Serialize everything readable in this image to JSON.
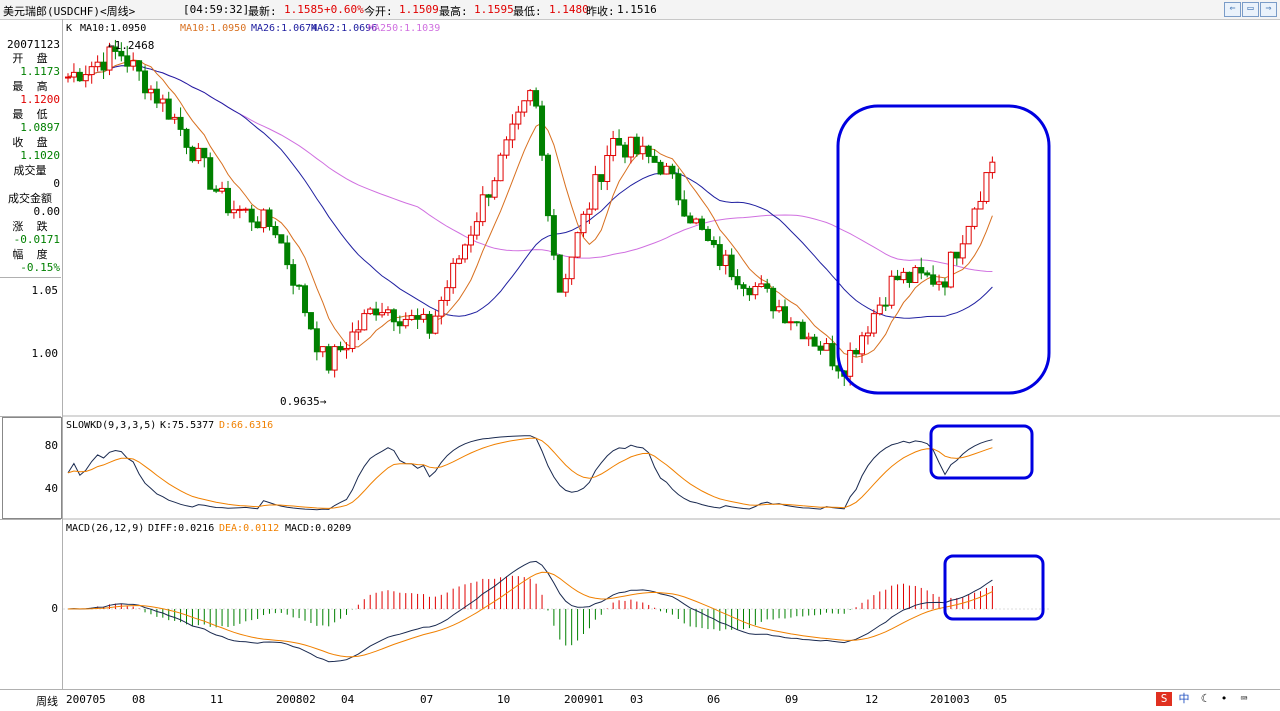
{
  "topbar": {
    "symbol": "美元瑞郎(USDCHF)<周线>",
    "time": "[04:59:32]",
    "latest_label": "最新:",
    "latest_value": "1.1585",
    "change": "+0.60%",
    "open_label": "今开:",
    "open_value": "1.1509",
    "high_label": "最高:",
    "high_value": "1.1595",
    "low_label": "最低:",
    "low_value": "1.1480",
    "prev_label": "昨收:",
    "prev_value": "1.1516"
  },
  "legend": {
    "k": "K",
    "ma10a": "MA10:1.0950",
    "ma10b": "MA10:1.0950",
    "ma26": "MA26:1.0674",
    "ma62": "MA62:1.0696",
    "ma250": "MA250:1.1039"
  },
  "info": {
    "date": "20071123",
    "open_label": "开  盘",
    "open": "1.1173",
    "high_label": "最  高",
    "high": "1.1200",
    "low_label": "最  低",
    "low": "1.0897",
    "close_label": "收  盘",
    "close": "1.1020",
    "volume_label": "成交量",
    "volume": "0",
    "amount_label": "成交金额",
    "amount": "0.00",
    "change_label": "涨  跌",
    "change": "-0.0171",
    "pct_label": "幅  度",
    "pct": "-0.15%"
  },
  "price_axis": {
    "tick1": "1.05",
    "tick2": "1.00"
  },
  "annotations": {
    "max": "1.2468",
    "min": "0.9635"
  },
  "kd": {
    "title": "SLOWKD(9,3,3,5)",
    "k": "K:75.5377",
    "d": "D:66.6316",
    "tick80": "80",
    "tick40": "40"
  },
  "macd": {
    "title": "MACD(26,12,9)",
    "diff": "DIFF:0.0216",
    "dea": "DEA:0.0112",
    "macd": "MACD:0.0209",
    "tick0": "0"
  },
  "xaxis": {
    "label": "周线",
    "ticks": [
      "200705",
      "08",
      "11",
      "200802",
      "04",
      "07",
      "10",
      "200901",
      "03",
      "06",
      "09",
      "12",
      "201003",
      "05"
    ]
  },
  "colors": {
    "up": "#e00000",
    "down": "#008000",
    "ma10": "#d87020",
    "ma26": "#2020a0",
    "ma250": "#d070e0",
    "k_line": "#1a2a50",
    "d_line": "#f08000",
    "highlight": "#0000e0"
  },
  "chart_data": {
    "type": "candlestick",
    "title": "美元瑞郎(USDCHF)<周线>",
    "period": "weekly",
    "x_range": [
      "2007-05",
      "2010-06"
    ],
    "ylim": [
      0.96,
      1.25
    ],
    "max_point": {
      "value": 1.2468
    },
    "min_point": {
      "value": 0.9635
    },
    "approx_path": [
      {
        "t": "2007-05",
        "v": 1.22
      },
      {
        "t": "2007-07",
        "v": 1.24
      },
      {
        "t": "2007-09",
        "v": 1.19
      },
      {
        "t": "2007-11",
        "v": 1.12
      },
      {
        "t": "2008-01",
        "v": 1.1
      },
      {
        "t": "2008-03",
        "v": 0.99
      },
      {
        "t": "2008-05",
        "v": 1.04
      },
      {
        "t": "2008-07",
        "v": 1.02
      },
      {
        "t": "2008-09",
        "v": 1.12
      },
      {
        "t": "2008-11",
        "v": 1.21
      },
      {
        "t": "2008-12",
        "v": 1.05
      },
      {
        "t": "2009-02",
        "v": 1.17
      },
      {
        "t": "2009-04",
        "v": 1.15
      },
      {
        "t": "2009-06",
        "v": 1.08
      },
      {
        "t": "2009-09",
        "v": 1.03
      },
      {
        "t": "2009-11",
        "v": 0.99
      },
      {
        "t": "2010-01",
        "v": 1.06
      },
      {
        "t": "2010-03",
        "v": 1.06
      },
      {
        "t": "2010-05",
        "v": 1.16
      }
    ],
    "indicators": {
      "slowkd": {
        "K": 75.5377,
        "D": 66.6316,
        "ylim": [
          20,
          100
        ],
        "ticks": [
          80,
          40
        ]
      },
      "macd": {
        "DIFF": 0.0216,
        "DEA": 0.0112,
        "MACD": 0.0209
      }
    }
  }
}
